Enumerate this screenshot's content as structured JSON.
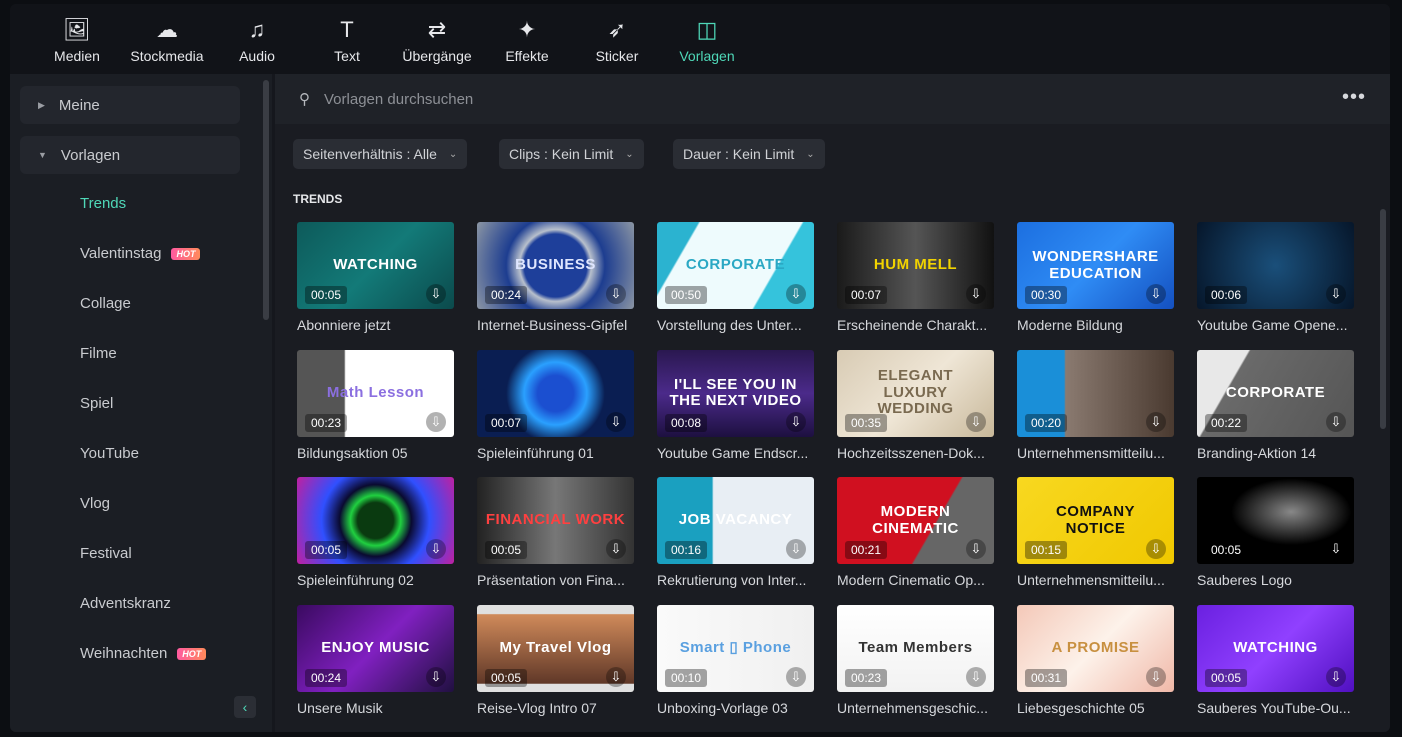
{
  "nav": [
    {
      "label": "Medien",
      "icon": "media-icon",
      "glyph": "🖼"
    },
    {
      "label": "Stockmedia",
      "icon": "stockmedia-icon",
      "glyph": "☁"
    },
    {
      "label": "Audio",
      "icon": "music-note-icon",
      "glyph": "♫"
    },
    {
      "label": "Text",
      "icon": "text-icon",
      "glyph": "T"
    },
    {
      "label": "Übergänge",
      "icon": "transitions-icon",
      "glyph": "⇄"
    },
    {
      "label": "Effekte",
      "icon": "effects-icon",
      "glyph": "✦"
    },
    {
      "label": "Sticker",
      "icon": "sticker-icon",
      "glyph": "➶"
    },
    {
      "label": "Vorlagen",
      "icon": "templates-icon",
      "glyph": "◫",
      "active": true
    }
  ],
  "accent": "#4fd8b8",
  "sidebar": {
    "groups": [
      {
        "label": "Meine",
        "expanded": false
      },
      {
        "label": "Vorlagen",
        "expanded": true
      }
    ],
    "items": [
      {
        "label": "Trends",
        "active": true
      },
      {
        "label": "Valentinstag",
        "badge": "HOT"
      },
      {
        "label": "Collage"
      },
      {
        "label": "Filme"
      },
      {
        "label": "Spiel"
      },
      {
        "label": "YouTube"
      },
      {
        "label": "Vlog"
      },
      {
        "label": "Festival"
      },
      {
        "label": "Adventskranz"
      },
      {
        "label": "Weihnachten",
        "badge": "HOT"
      }
    ]
  },
  "search": {
    "placeholder": "Vorlagen durchsuchen"
  },
  "filters": [
    "Seitenverhältnis : Alle",
    "Clips : Kein Limit",
    "Dauer : Kein Limit"
  ],
  "section": "TRENDS",
  "cards": [
    {
      "title": "Abonniere jetzt",
      "duration": "00:05",
      "thumb_text": "WATCHING",
      "bg": "linear-gradient(135deg,#0d5a5a,#137a78,#0b4a4c)",
      "fg": "#fff"
    },
    {
      "title": "Internet-Business-Gipfel",
      "duration": "00:24",
      "thumb_text": "BUSINESS",
      "bg": "radial-gradient(circle,#1e3f9a 35%,#b8c0cc 40%,#1d3d90 55%,#8c96a4)",
      "fg": "#dfe6ff"
    },
    {
      "title": "Vorstellung des Unter...",
      "duration": "00:50",
      "thumb_text": "CORPORATE",
      "bg": "linear-gradient(120deg,#2bb3d0 20%,#eefbfd 21%,#eefbfd 70%,#35c3dc 71%)",
      "fg": "#2aa8c4"
    },
    {
      "title": "Erscheinende Charakt...",
      "duration": "00:07",
      "thumb_text": "HUM MELL",
      "bg": "linear-gradient(90deg,#1a1a1a,#555,#111)",
      "fg": "#f1d300"
    },
    {
      "title": "Moderne Bildung",
      "duration": "00:30",
      "thumb_text": "WONDERSHARE EDUCATION",
      "bg": "linear-gradient(135deg,#1c6fe0,#2f8cf5,#1450c0)",
      "fg": "#fff"
    },
    {
      "title": "Youtube Game Opene...",
      "duration": "00:06",
      "thumb_text": "",
      "bg": "radial-gradient(circle,#1a4f7a,#06162a)",
      "fg": "#9fe3ff"
    },
    {
      "title": "Bildungsaktion 05",
      "duration": "00:23",
      "thumb_text": "Math Lesson",
      "bg": "linear-gradient(90deg,#555 30%,#fff 31%)",
      "fg": "#8b6fe0"
    },
    {
      "title": "Spieleinführung 01",
      "duration": "00:07",
      "thumb_text": "",
      "bg": "radial-gradient(circle,#1b4fd0 20%,#2aa0ff 35%,#0a1e52 55%)",
      "fg": "#fff"
    },
    {
      "title": "Youtube Game Endscr...",
      "duration": "00:08",
      "thumb_text": "I'LL SEE YOU IN THE NEXT VIDEO",
      "bg": "linear-gradient(180deg,#2a1850,#4b2a8a,#1d1040)",
      "fg": "#fff"
    },
    {
      "title": "Hochzeitsszenen-Dok...",
      "duration": "00:35",
      "thumb_text": "ELEGANT LUXURY WEDDING",
      "bg": "linear-gradient(135deg,#d8cbb4,#efe6d6,#c8b89a)",
      "fg": "#7a6a50"
    },
    {
      "title": "Unternehmensmitteilu...",
      "duration": "00:20",
      "thumb_text": "",
      "bg": "linear-gradient(90deg,#1a8fd8 30%,#8a7a70 31%,#4a3a30)",
      "fg": "#fff"
    },
    {
      "title": "Branding-Aktion 14",
      "duration": "00:22",
      "thumb_text": "CORPORATE",
      "bg": "linear-gradient(120deg,#e8e8e8 25%,#6a6a6a 26%,#555)",
      "fg": "#fff"
    },
    {
      "title": "Spieleinführung 02",
      "duration": "00:05",
      "thumb_text": "",
      "bg": "radial-gradient(circle,#0a3a10 20%,#20d040 28%,#0a0a30 40%,#3050ff 60%,#c020a0)",
      "fg": "#fff"
    },
    {
      "title": "Präsentation von Fina...",
      "duration": "00:05",
      "thumb_text": "FINANCIAL WORK",
      "bg": "linear-gradient(90deg,#222,#777,#333)",
      "fg": "#ff4040"
    },
    {
      "title": "Rekrutierung von Inter...",
      "duration": "00:16",
      "thumb_text": "JOB VACANCY",
      "bg": "linear-gradient(90deg,#1aa0c0 35%,#e8eef4 36%)",
      "fg": "#fff"
    },
    {
      "title": "Modern Cinematic Op...",
      "duration": "00:21",
      "thumb_text": "MODERN CINEMATIC",
      "bg": "linear-gradient(120deg,#d01020 60%,#666 61%)",
      "fg": "#fff"
    },
    {
      "title": "Unternehmensmitteilu...",
      "duration": "00:15",
      "thumb_text": "COMPANY NOTICE",
      "bg": "linear-gradient(135deg,#f8d820,#f0c800)",
      "fg": "#111"
    },
    {
      "title": "Sauberes Logo",
      "duration": "00:05",
      "thumb_text": "",
      "bg": "radial-gradient(ellipse at 60% 40%,#888,#000 45%)",
      "fg": "#fff"
    },
    {
      "title": "Unsere Musik",
      "duration": "00:24",
      "thumb_text": "ENJOY MUSIC",
      "bg": "linear-gradient(135deg,#3a0a60,#8020c0,#201040)",
      "fg": "#fff"
    },
    {
      "title": "Reise-Vlog Intro 07",
      "duration": "00:05",
      "thumb_text": "My Travel Vlog",
      "bg": "linear-gradient(180deg,#e0e0e0 10%,#d08a5a 11%,#603828 90%,#e0e0e0 91%)",
      "fg": "#fff"
    },
    {
      "title": "Unboxing-Vorlage 03",
      "duration": "00:10",
      "thumb_text": "Smart  ▯  Phone",
      "bg": "linear-gradient(90deg,#fafafa,#f0f0f0)",
      "fg": "#5aa0e0"
    },
    {
      "title": "Unternehmensgeschic...",
      "duration": "00:23",
      "thumb_text": "Team Members",
      "bg": "linear-gradient(180deg,#fff,#f2f2f2)",
      "fg": "#333"
    },
    {
      "title": "Liebesgeschichte 05",
      "duration": "00:31",
      "thumb_text": "A PROMISE",
      "bg": "linear-gradient(135deg,#f4c8b8,#fdf2ea,#f0b8a8)",
      "fg": "#c89040"
    },
    {
      "title": "Sauberes YouTube-Ou...",
      "duration": "00:05",
      "thumb_text": "WATCHING",
      "bg": "linear-gradient(135deg,#6a20e0,#9040ff,#5010c0)",
      "fg": "#fff"
    }
  ]
}
